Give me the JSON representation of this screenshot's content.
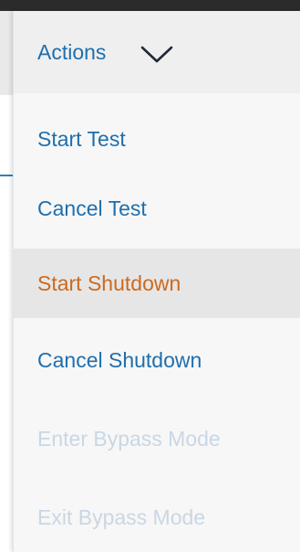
{
  "dropdown": {
    "title": "Actions",
    "items": [
      {
        "label": "Start Test",
        "state": "enabled"
      },
      {
        "label": "Cancel Test",
        "state": "enabled"
      },
      {
        "label": "Start Shutdown",
        "state": "hovered"
      },
      {
        "label": "Cancel Shutdown",
        "state": "enabled"
      },
      {
        "label": "Enter Bypass Mode",
        "state": "disabled"
      },
      {
        "label": "Exit Bypass Mode",
        "state": "disabled"
      }
    ]
  },
  "colors": {
    "link": "#1f6fad",
    "hover_text": "#cc6a1e",
    "disabled_text": "#c9d7e4",
    "hover_background": "#e6e6e6"
  },
  "icons": {
    "header_chevron": "chevron-down-icon"
  }
}
